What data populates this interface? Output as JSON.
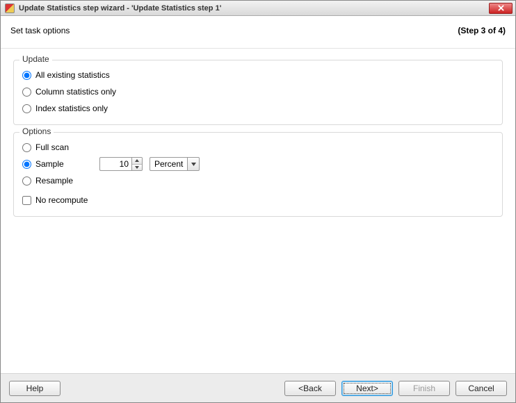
{
  "window": {
    "title": "Update Statistics step wizard - 'Update Statistics step 1'"
  },
  "subheader": {
    "task_label": "Set task options",
    "step_label": "(Step 3 of 4)"
  },
  "update_group": {
    "legend": "Update",
    "opt_all": "All existing statistics",
    "opt_column": "Column statistics only",
    "opt_index": "Index statistics only",
    "selected": "all"
  },
  "options_group": {
    "legend": "Options",
    "opt_fullscan": "Full scan",
    "opt_sample": "Sample",
    "opt_resample": "Resample",
    "selected": "sample",
    "sample_value": "10",
    "sample_unit": "Percent",
    "no_recompute": "No recompute",
    "no_recompute_checked": false
  },
  "buttons": {
    "help": "Help",
    "back": "<Back",
    "next": "Next>",
    "finish": "Finish",
    "cancel": "Cancel"
  }
}
